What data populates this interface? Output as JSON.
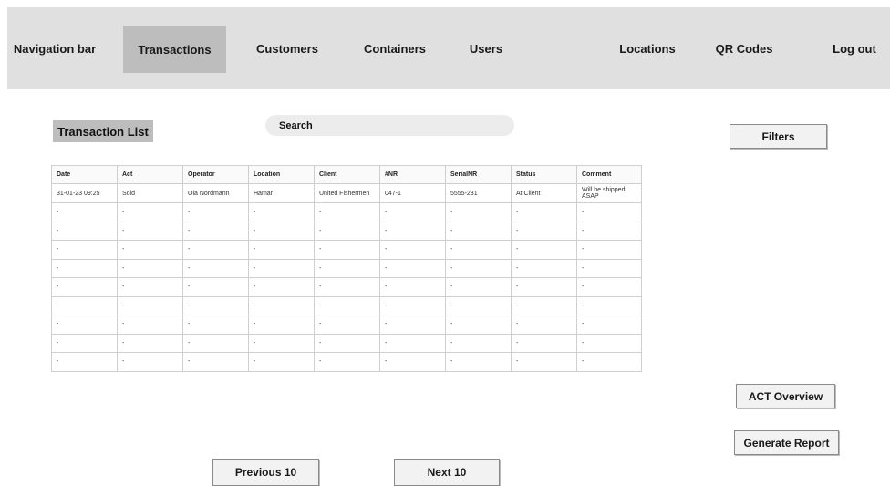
{
  "nav": {
    "items": [
      {
        "label": "Navigation bar",
        "name": "nav-label"
      },
      {
        "label": "Transactions",
        "name": "nav-transactions"
      },
      {
        "label": "Customers",
        "name": "nav-customers"
      },
      {
        "label": "Containers",
        "name": "nav-containers"
      },
      {
        "label": "Users",
        "name": "nav-users"
      },
      {
        "label": "Locations",
        "name": "nav-locations"
      },
      {
        "label": "QR Codes",
        "name": "nav-qr-codes"
      },
      {
        "label": "Log out",
        "name": "nav-log-out"
      }
    ]
  },
  "page": {
    "title": "Transaction List",
    "search_label": "Search"
  },
  "buttons": {
    "filters": "Filters",
    "act_overview": "ACT Overview",
    "generate_report": "Generate Report",
    "previous": "Previous 10",
    "next": "Next 10"
  },
  "table": {
    "columns": [
      "Date",
      "Act",
      "Operator",
      "Location",
      "Client",
      "#NR",
      "SerialNR",
      "Status",
      "Comment"
    ],
    "rows": [
      [
        "31-01-23 09:25",
        "Sold",
        "Ola Nordmann",
        "Hamar",
        "United Fishermen",
        "047-1",
        "5555-231",
        "At Client",
        "Will be shipped ASAP"
      ],
      [
        "-",
        "-",
        "-",
        "-",
        "-",
        "-",
        "-",
        "-",
        "-"
      ],
      [
        "-",
        "-",
        "-",
        "-",
        "-",
        "-",
        "-",
        "-",
        "-"
      ],
      [
        "-",
        "-",
        "-",
        "-",
        "-",
        "-",
        "-",
        "-",
        "-"
      ],
      [
        "-",
        "-",
        "-",
        "-",
        "-",
        "-",
        "-",
        "-",
        "-"
      ],
      [
        "-",
        "-",
        "-",
        "-",
        "-",
        "-",
        "-",
        "-",
        "-"
      ],
      [
        "-",
        "-",
        "-",
        "-",
        "-",
        "-",
        "-",
        "-",
        "-"
      ],
      [
        "-",
        "-",
        "-",
        "-",
        "-",
        "-",
        "-",
        "-",
        "-"
      ],
      [
        "-",
        "-",
        "-",
        "-",
        "-",
        "-",
        "-",
        "-",
        "-"
      ],
      [
        "-",
        "-",
        "-",
        "-",
        "-",
        "-",
        "-",
        "-",
        "-"
      ]
    ]
  }
}
